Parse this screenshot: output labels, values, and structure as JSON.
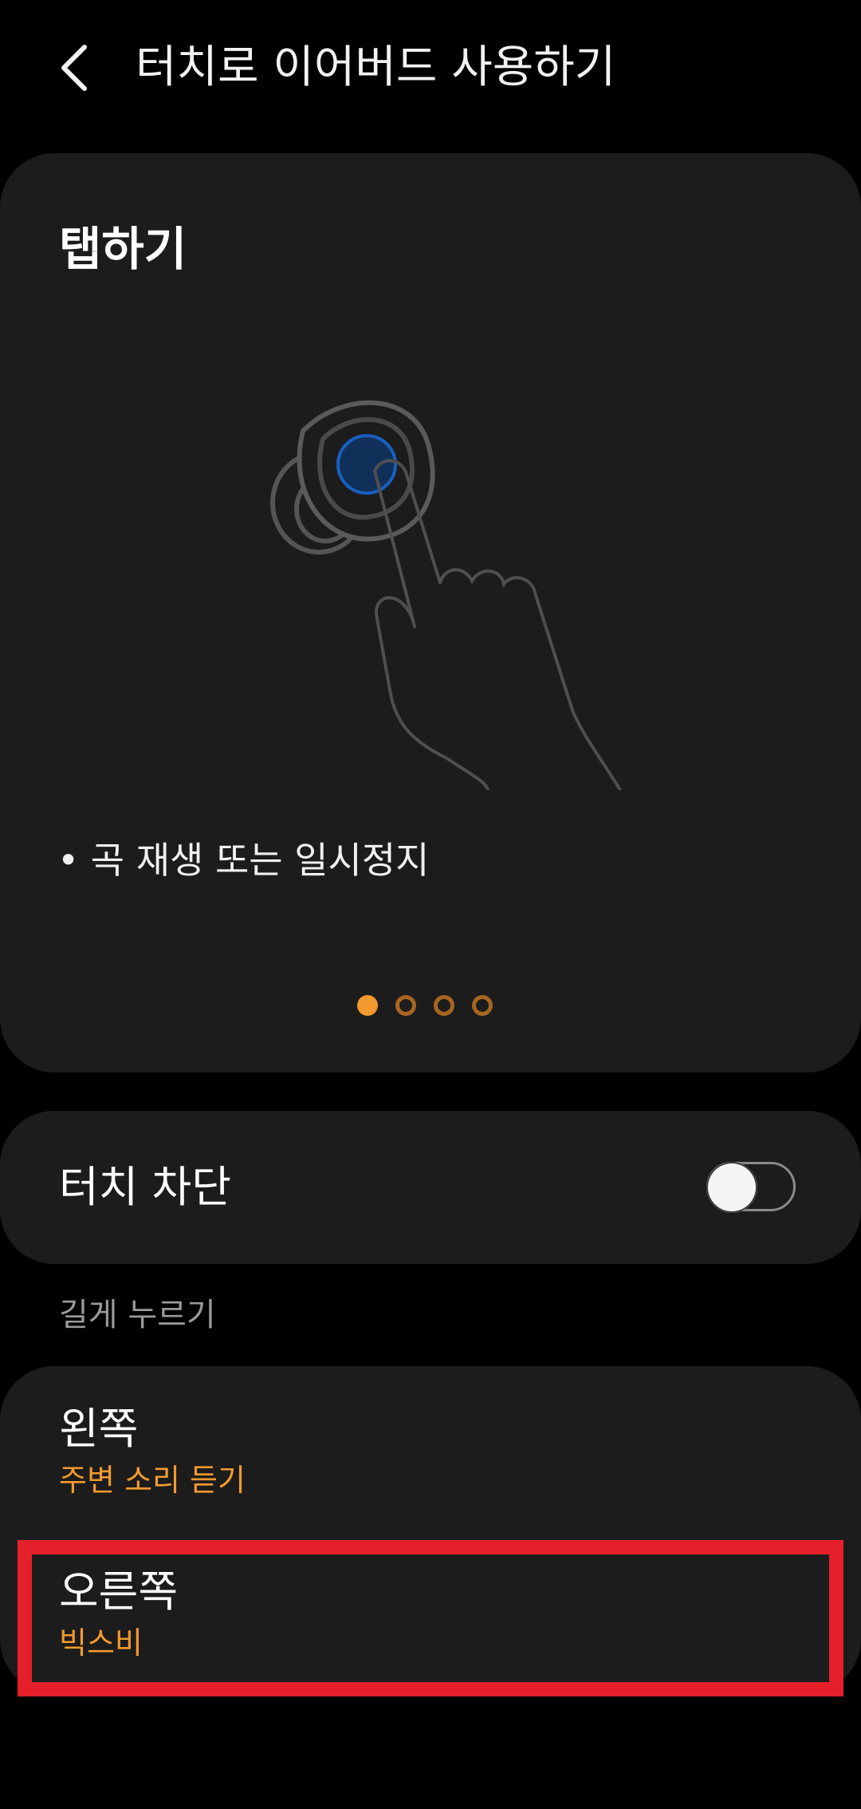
{
  "header": {
    "back_icon": "chevron-left-icon",
    "title": "터치로 이어버드 사용하기"
  },
  "gesture_card": {
    "title": "탭하기",
    "illustration_icon": "tap-earbud-icon",
    "description": "• 곡 재생 또는 일시정지",
    "pager": {
      "total": 4,
      "active_index": 0
    }
  },
  "touch_lock": {
    "label": "터치 차단",
    "enabled": false
  },
  "long_press": {
    "section_label": "길게 누르기",
    "items": [
      {
        "title": "왼쪽",
        "value": "주변 소리 듣기"
      },
      {
        "title": "오른쪽",
        "value": "빅스비"
      }
    ]
  },
  "colors": {
    "background": "#000000",
    "card": "#1c1c1c",
    "accent": "#f29a2e",
    "highlight": "#e5202a",
    "earbud_dot": "#1a5fc0"
  }
}
